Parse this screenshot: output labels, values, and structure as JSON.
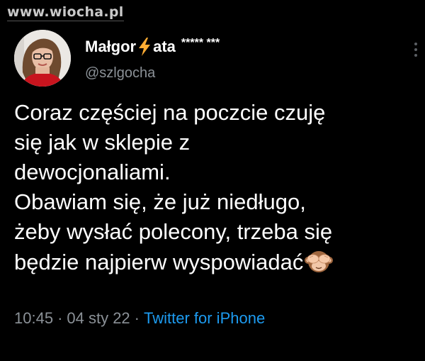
{
  "watermark": "www.wiocha.pl",
  "author": {
    "name_part1": "Małgor",
    "name_part2": "ata",
    "name_suffix": "***** ***",
    "handle": "@szlgocha"
  },
  "tweet": {
    "lines": [
      "Coraz częściej na poczcie czuję",
      "się jak w sklepie z",
      "dewocjonaliami.",
      "Obawiam się, że już niedługo,",
      "żeby wysłać polecony, trzeba się",
      "będzie najpierw wyspowiadać"
    ],
    "time": "10:45",
    "date": "04 sty 22",
    "separator": "·",
    "source": "Twitter for iPhone"
  },
  "icons": {
    "name_emoji": "lightning-bolt",
    "text_emoji": "see-no-evil-monkey",
    "menu": "more-vertical"
  },
  "colors": {
    "background": "#000000",
    "text": "#ffffff",
    "secondary": "#8b9197",
    "link": "#1d9bf0",
    "bolt": "#ffac33"
  }
}
